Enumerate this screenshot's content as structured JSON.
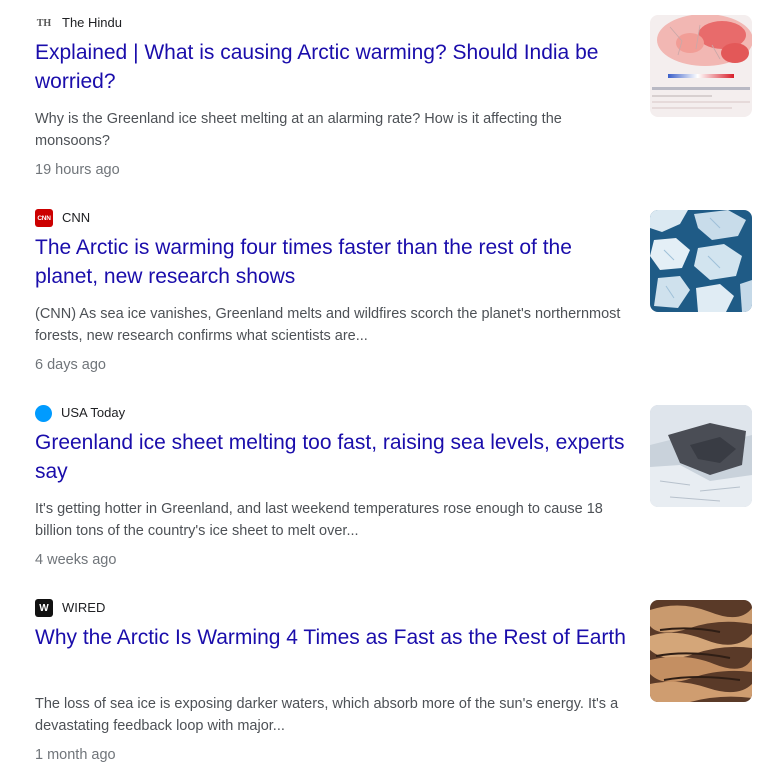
{
  "articles": [
    {
      "source": "The Hindu",
      "source_icon": "the-hindu-logo",
      "source_logo_text": "TH",
      "title": "Explained | What is causing Arctic warming? Should India be worried?",
      "snippet": "Why is the Greenland ice sheet melting at an alarming rate? How is it affecting the monsoons?",
      "time": "19 hours ago"
    },
    {
      "source": "CNN",
      "source_icon": "cnn-logo",
      "source_logo_text": "CNN",
      "title": "The Arctic is warming four times faster than the rest of the planet, new research shows",
      "snippet": "(CNN) As sea ice vanishes, Greenland melts and wildfires scorch the planet's northernmost forests, new research confirms what scientists are...",
      "time": "6 days ago"
    },
    {
      "source": "USA Today",
      "source_icon": "usa-today-logo",
      "source_logo_text": "",
      "title": "Greenland ice sheet melting too fast, raising sea levels, experts say",
      "snippet": "It's getting hotter in Greenland, and last weekend temperatures rose enough to cause 18 billion tons of the country's ice sheet to melt over...",
      "time": "4 weeks ago"
    },
    {
      "source": "WIRED",
      "source_icon": "wired-logo",
      "source_logo_text": "W",
      "title": "Why the Arctic Is Warming 4 Times as Fast as the Rest of Earth",
      "snippet": "The loss of sea ice is exposing darker waters, which absorb more of the sun's energy. It's a devastating feedback loop with major...",
      "time": "1 month ago"
    }
  ],
  "colors": {
    "headline": "#1a0dab",
    "snippet": "#4d5156",
    "timestamp": "#70757a",
    "source": "#202124",
    "cnn_red": "#cc0000",
    "usa_today_blue": "#009bff"
  }
}
